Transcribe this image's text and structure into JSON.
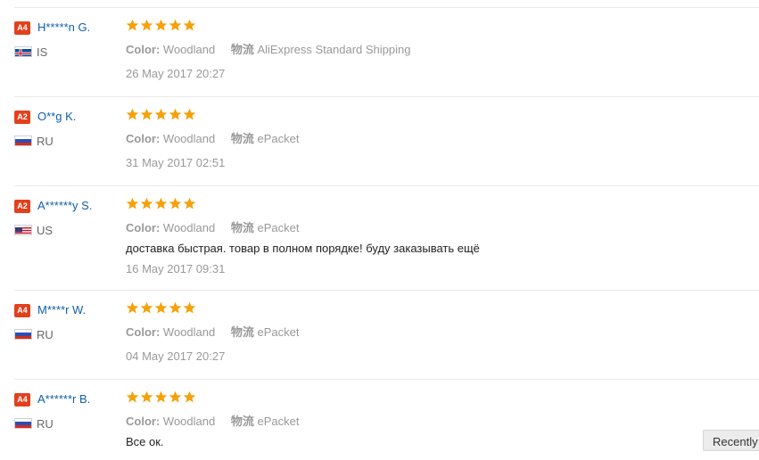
{
  "labels": {
    "color": "Color:",
    "shipping": "物流"
  },
  "reviews": [
    {
      "badge": "A4",
      "name": "H*****n G.",
      "country": "IS",
      "rating": 5,
      "color": "Woodland",
      "shipping": "AliExpress Standard Shipping",
      "comment": "",
      "date": "26 May 2017 20:27"
    },
    {
      "badge": "A2",
      "name": "O**g K.",
      "country": "RU",
      "rating": 5,
      "color": "Woodland",
      "shipping": "ePacket",
      "comment": "",
      "date": "31 May 2017 02:51"
    },
    {
      "badge": "A2",
      "name": "A******y S.",
      "country": "US",
      "rating": 5,
      "color": "Woodland",
      "shipping": "ePacket",
      "comment": "доставка быстрая. товар в полном порядке! буду заказывать ещё",
      "date": "16 May 2017 09:31"
    },
    {
      "badge": "A4",
      "name": "M****r W.",
      "country": "RU",
      "rating": 5,
      "color": "Woodland",
      "shipping": "ePacket",
      "comment": "",
      "date": "04 May 2017 20:27"
    },
    {
      "badge": "A4",
      "name": "A******r B.",
      "country": "RU",
      "rating": 5,
      "color": "Woodland",
      "shipping": "ePacket",
      "comment": "Все ок.",
      "date": ""
    }
  ],
  "sort_button": {
    "label": "Recently"
  },
  "colors": {
    "badge": "#e2401c",
    "name_link": "#0e5fab",
    "star": "#f5a10a"
  }
}
